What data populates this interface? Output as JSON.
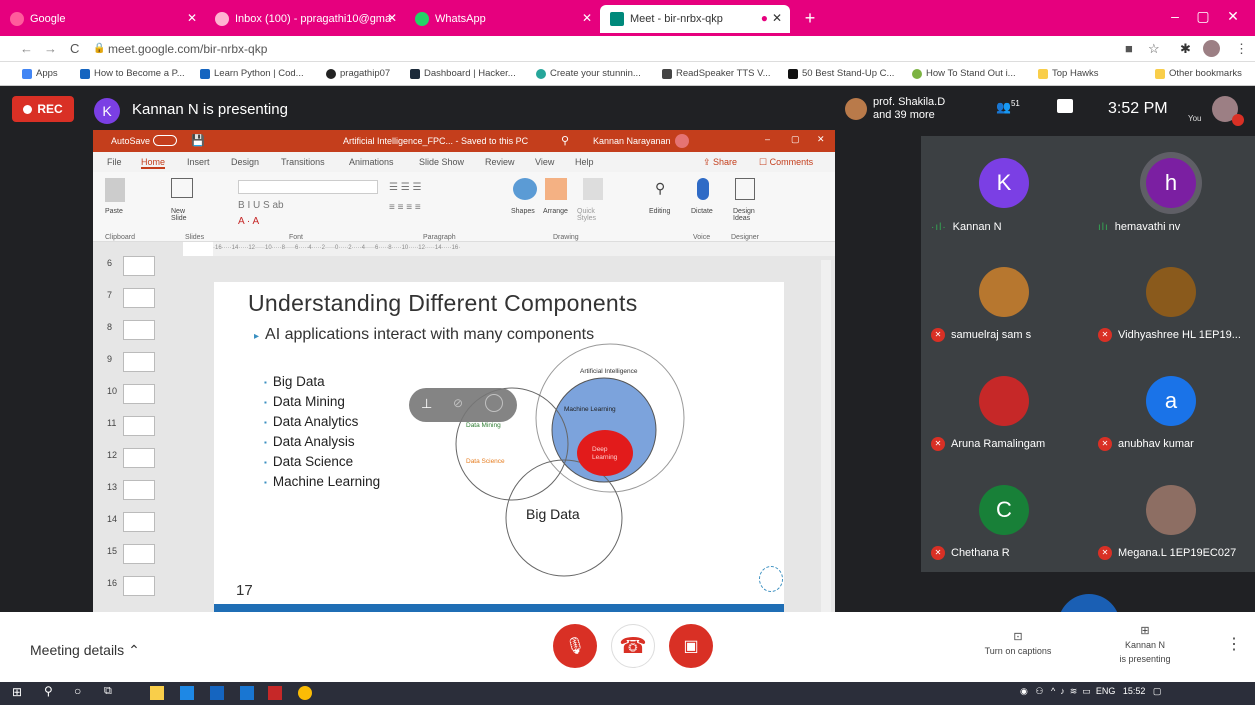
{
  "browser": {
    "tabs": [
      {
        "title": "Google",
        "color": "#ff5c9c"
      },
      {
        "title": "Inbox (100) - ppragathi10@gma",
        "color": "#ffb3d1"
      },
      {
        "title": "WhatsApp",
        "color": "#25d366"
      },
      {
        "title": "Meet - bir-nrbx-qkp",
        "color": "#00897b"
      }
    ],
    "new_tab": "+",
    "url": "meet.google.com/bir-nrbx-qkp",
    "bookmarks": [
      "Apps",
      "How to Become a P...",
      "Learn Python | Cod...",
      "pragathip07",
      "Dashboard | Hacker...",
      "Create your stunnin...",
      "ReadSpeaker TTS V...",
      "50 Best Stand-Up C...",
      "How To Stand Out i...",
      "Top Hawks",
      "Other bookmarks"
    ]
  },
  "meet": {
    "rec_label": "REC",
    "presenter_initial": "K",
    "presenter_text": "Kannan N is presenting",
    "host_line1": "prof. Shakila.D",
    "host_line2": "and 39 more",
    "people_count": "51",
    "time": "3:52 PM",
    "you_label": "You"
  },
  "ppt": {
    "title_left": "AutoSave",
    "title_doc": "Artificial Intelligence_FPC... - Saved to this PC",
    "title_user": "Kannan Narayanan",
    "tabs": [
      "File",
      "Home",
      "Insert",
      "Design",
      "Transitions",
      "Animations",
      "Slide Show",
      "Review",
      "View",
      "Help"
    ],
    "share": "Share",
    "comments": "Comments",
    "groups": [
      "Clipboard",
      "Slides",
      "Font",
      "Paragraph",
      "Drawing",
      "Voice",
      "Designer"
    ],
    "ribbon_labels": [
      "Paste",
      "New Slide",
      "Shapes",
      "Arrange",
      "Quick Styles",
      "Editing",
      "Dictate",
      "Design Ideas"
    ],
    "thumb_numbers": [
      "6",
      "7",
      "8",
      "9",
      "10",
      "11",
      "12",
      "13",
      "14",
      "15",
      "16"
    ],
    "slide": {
      "title": "Understanding Different Components",
      "bullet": "AI applications interact with many components",
      "list": [
        "Big Data",
        "Data Mining",
        "Data Analytics",
        "Data Analysis",
        "Data Science",
        "Machine Learning"
      ],
      "venn": {
        "ai": "Artificial Intelligence",
        "ml": "Machine Learning",
        "dl": "Deep Learning",
        "dm": "Data Mining",
        "ds": "Data Science",
        "bd": "Big Data"
      },
      "number": "17"
    }
  },
  "participants": [
    {
      "name": "Kannan N",
      "initial": "K",
      "color": "#7b3fe4",
      "muted": false
    },
    {
      "name": "hemavathi nv",
      "initial": "h",
      "color": "#7b1fa2",
      "muted": false
    },
    {
      "name": "samuelraj sam s",
      "initial": "",
      "color": "#b7772f",
      "muted": true
    },
    {
      "name": "Vidhyashree HL 1EP19...",
      "initial": "",
      "color": "#8a5a1c",
      "muted": true
    },
    {
      "name": "Aruna Ramalingam",
      "initial": "",
      "color": "#c62828",
      "muted": true
    },
    {
      "name": "anubhav kumar",
      "initial": "a",
      "color": "#1a73e8",
      "muted": true
    },
    {
      "name": "Chethana R",
      "initial": "C",
      "color": "#188038",
      "muted": true
    },
    {
      "name": "Megana.L 1EP19EC027",
      "initial": "",
      "color": "#8d6e63",
      "muted": true
    }
  ],
  "bottom": {
    "meeting_details": "Meeting details",
    "captions": "Turn on captions",
    "presenting_line1": "Kannan N",
    "presenting_line2": "is presenting"
  },
  "taskbar": {
    "lang": "ENG",
    "time": "15:52"
  }
}
